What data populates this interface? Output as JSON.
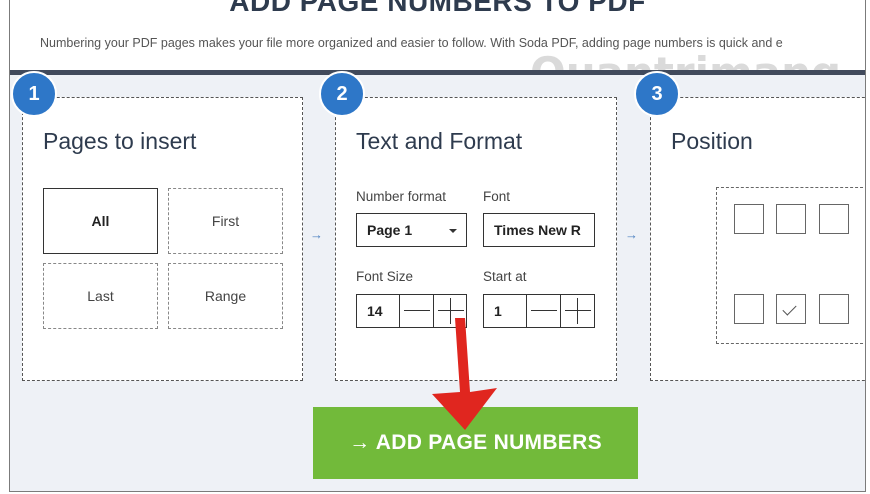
{
  "header": {
    "title": "ADD PAGE NUMBERS TO PDF",
    "subtitle": "Numbering your PDF pages makes your file more organized and easier to follow. With Soda PDF, adding page numbers is quick and e"
  },
  "watermark": "Quantrimang",
  "step1": {
    "number": "1",
    "title": "Pages to insert",
    "options": [
      "All",
      "First",
      "Last",
      "Range"
    ],
    "selected": "All"
  },
  "step2": {
    "number": "2",
    "title": "Text and Format",
    "number_format_label": "Number format",
    "number_format_value": "Page 1",
    "font_label": "Font",
    "font_value": "Times New R",
    "font_size_label": "Font Size",
    "font_size_value": "14",
    "start_at_label": "Start at",
    "start_at_value": "1"
  },
  "step3": {
    "number": "3",
    "title": "Position",
    "selected_position": "bottom-center"
  },
  "flow_arrow": "→",
  "add_button": "→ ADD PAGE NUMBERS",
  "colors": {
    "badge": "#2e77c8",
    "button": "#72ba3a",
    "annotation_arrow": "#e0261f"
  }
}
